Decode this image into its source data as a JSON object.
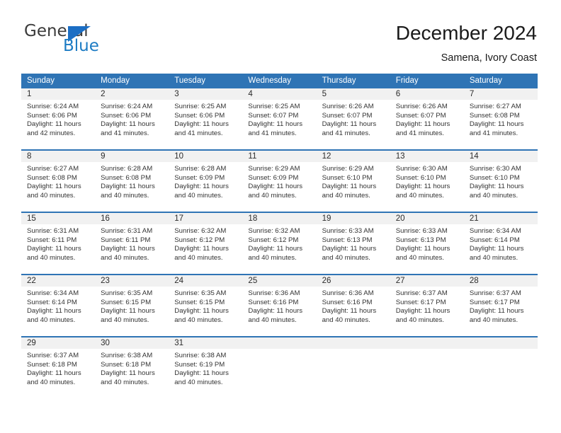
{
  "logo": {
    "word_top": "General",
    "word_bottom": "Blue",
    "triangle_color": "#1b6ec4",
    "blue_text_color": "#1d7cc4",
    "gray_text_color": "#3b3b3b"
  },
  "header": {
    "month_title": "December 2024",
    "location": "Samena, Ivory Coast"
  },
  "calendar": {
    "header_color": "#2f74b5",
    "daynum_band_color": "#f1f1f1",
    "weekdays": [
      "Sunday",
      "Monday",
      "Tuesday",
      "Wednesday",
      "Thursday",
      "Friday",
      "Saturday"
    ],
    "weeks": [
      [
        {
          "day": "1",
          "sunrise": "Sunrise: 6:24 AM",
          "sunset": "Sunset: 6:06 PM",
          "daylight": "Daylight: 11 hours and 42 minutes."
        },
        {
          "day": "2",
          "sunrise": "Sunrise: 6:24 AM",
          "sunset": "Sunset: 6:06 PM",
          "daylight": "Daylight: 11 hours and 41 minutes."
        },
        {
          "day": "3",
          "sunrise": "Sunrise: 6:25 AM",
          "sunset": "Sunset: 6:06 PM",
          "daylight": "Daylight: 11 hours and 41 minutes."
        },
        {
          "day": "4",
          "sunrise": "Sunrise: 6:25 AM",
          "sunset": "Sunset: 6:07 PM",
          "daylight": "Daylight: 11 hours and 41 minutes."
        },
        {
          "day": "5",
          "sunrise": "Sunrise: 6:26 AM",
          "sunset": "Sunset: 6:07 PM",
          "daylight": "Daylight: 11 hours and 41 minutes."
        },
        {
          "day": "6",
          "sunrise": "Sunrise: 6:26 AM",
          "sunset": "Sunset: 6:07 PM",
          "daylight": "Daylight: 11 hours and 41 minutes."
        },
        {
          "day": "7",
          "sunrise": "Sunrise: 6:27 AM",
          "sunset": "Sunset: 6:08 PM",
          "daylight": "Daylight: 11 hours and 41 minutes."
        }
      ],
      [
        {
          "day": "8",
          "sunrise": "Sunrise: 6:27 AM",
          "sunset": "Sunset: 6:08 PM",
          "daylight": "Daylight: 11 hours and 40 minutes."
        },
        {
          "day": "9",
          "sunrise": "Sunrise: 6:28 AM",
          "sunset": "Sunset: 6:08 PM",
          "daylight": "Daylight: 11 hours and 40 minutes."
        },
        {
          "day": "10",
          "sunrise": "Sunrise: 6:28 AM",
          "sunset": "Sunset: 6:09 PM",
          "daylight": "Daylight: 11 hours and 40 minutes."
        },
        {
          "day": "11",
          "sunrise": "Sunrise: 6:29 AM",
          "sunset": "Sunset: 6:09 PM",
          "daylight": "Daylight: 11 hours and 40 minutes."
        },
        {
          "day": "12",
          "sunrise": "Sunrise: 6:29 AM",
          "sunset": "Sunset: 6:10 PM",
          "daylight": "Daylight: 11 hours and 40 minutes."
        },
        {
          "day": "13",
          "sunrise": "Sunrise: 6:30 AM",
          "sunset": "Sunset: 6:10 PM",
          "daylight": "Daylight: 11 hours and 40 minutes."
        },
        {
          "day": "14",
          "sunrise": "Sunrise: 6:30 AM",
          "sunset": "Sunset: 6:10 PM",
          "daylight": "Daylight: 11 hours and 40 minutes."
        }
      ],
      [
        {
          "day": "15",
          "sunrise": "Sunrise: 6:31 AM",
          "sunset": "Sunset: 6:11 PM",
          "daylight": "Daylight: 11 hours and 40 minutes."
        },
        {
          "day": "16",
          "sunrise": "Sunrise: 6:31 AM",
          "sunset": "Sunset: 6:11 PM",
          "daylight": "Daylight: 11 hours and 40 minutes."
        },
        {
          "day": "17",
          "sunrise": "Sunrise: 6:32 AM",
          "sunset": "Sunset: 6:12 PM",
          "daylight": "Daylight: 11 hours and 40 minutes."
        },
        {
          "day": "18",
          "sunrise": "Sunrise: 6:32 AM",
          "sunset": "Sunset: 6:12 PM",
          "daylight": "Daylight: 11 hours and 40 minutes."
        },
        {
          "day": "19",
          "sunrise": "Sunrise: 6:33 AM",
          "sunset": "Sunset: 6:13 PM",
          "daylight": "Daylight: 11 hours and 40 minutes."
        },
        {
          "day": "20",
          "sunrise": "Sunrise: 6:33 AM",
          "sunset": "Sunset: 6:13 PM",
          "daylight": "Daylight: 11 hours and 40 minutes."
        },
        {
          "day": "21",
          "sunrise": "Sunrise: 6:34 AM",
          "sunset": "Sunset: 6:14 PM",
          "daylight": "Daylight: 11 hours and 40 minutes."
        }
      ],
      [
        {
          "day": "22",
          "sunrise": "Sunrise: 6:34 AM",
          "sunset": "Sunset: 6:14 PM",
          "daylight": "Daylight: 11 hours and 40 minutes."
        },
        {
          "day": "23",
          "sunrise": "Sunrise: 6:35 AM",
          "sunset": "Sunset: 6:15 PM",
          "daylight": "Daylight: 11 hours and 40 minutes."
        },
        {
          "day": "24",
          "sunrise": "Sunrise: 6:35 AM",
          "sunset": "Sunset: 6:15 PM",
          "daylight": "Daylight: 11 hours and 40 minutes."
        },
        {
          "day": "25",
          "sunrise": "Sunrise: 6:36 AM",
          "sunset": "Sunset: 6:16 PM",
          "daylight": "Daylight: 11 hours and 40 minutes."
        },
        {
          "day": "26",
          "sunrise": "Sunrise: 6:36 AM",
          "sunset": "Sunset: 6:16 PM",
          "daylight": "Daylight: 11 hours and 40 minutes."
        },
        {
          "day": "27",
          "sunrise": "Sunrise: 6:37 AM",
          "sunset": "Sunset: 6:17 PM",
          "daylight": "Daylight: 11 hours and 40 minutes."
        },
        {
          "day": "28",
          "sunrise": "Sunrise: 6:37 AM",
          "sunset": "Sunset: 6:17 PM",
          "daylight": "Daylight: 11 hours and 40 minutes."
        }
      ],
      [
        {
          "day": "29",
          "sunrise": "Sunrise: 6:37 AM",
          "sunset": "Sunset: 6:18 PM",
          "daylight": "Daylight: 11 hours and 40 minutes."
        },
        {
          "day": "30",
          "sunrise": "Sunrise: 6:38 AM",
          "sunset": "Sunset: 6:18 PM",
          "daylight": "Daylight: 11 hours and 40 minutes."
        },
        {
          "day": "31",
          "sunrise": "Sunrise: 6:38 AM",
          "sunset": "Sunset: 6:19 PM",
          "daylight": "Daylight: 11 hours and 40 minutes."
        },
        {
          "day": "",
          "sunrise": "",
          "sunset": "",
          "daylight": ""
        },
        {
          "day": "",
          "sunrise": "",
          "sunset": "",
          "daylight": ""
        },
        {
          "day": "",
          "sunrise": "",
          "sunset": "",
          "daylight": ""
        },
        {
          "day": "",
          "sunrise": "",
          "sunset": "",
          "daylight": ""
        }
      ]
    ]
  }
}
